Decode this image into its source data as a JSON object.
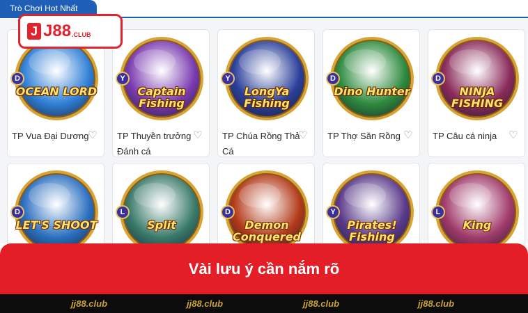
{
  "section_tab": "Trò Chơi Hot Nhất",
  "brand": {
    "mark": "J",
    "word": "J88",
    "suffix": ".CLUB"
  },
  "games": [
    {
      "name": "TP Vua Đại Dương",
      "badge": "D",
      "art": "OCEAN LORD",
      "ring": "#2f7fd6"
    },
    {
      "name": "TP Thuyền trưởng Đánh cá",
      "badge": "Y",
      "art": "Captain Fishing",
      "ring": "#7a3ab0"
    },
    {
      "name": "TP Chúa Rồng Thả Cá",
      "badge": "Y",
      "art": "LongYa Fishing",
      "ring": "#2a3f9a"
    },
    {
      "name": "TP Thợ Săn Rồng",
      "badge": "D",
      "art": "Dino Hunter",
      "ring": "#2d8a3e"
    },
    {
      "name": "TP Câu cá ninja",
      "badge": "D",
      "art": "NINJA FISHING",
      "ring": "#8a2a5a"
    },
    {
      "name": "",
      "badge": "D",
      "art": "LET'S SHOOT",
      "ring": "#2a6fc0"
    },
    {
      "name": "",
      "badge": "L",
      "art": "Split",
      "ring": "#3a7a6a"
    },
    {
      "name": "",
      "badge": "D",
      "art": "Demon Conquered",
      "ring": "#b23a1a"
    },
    {
      "name": "",
      "badge": "Y",
      "art": "Pirates! Fishing",
      "ring": "#5a3a8a"
    },
    {
      "name": "",
      "badge": "L",
      "art": "King",
      "ring": "#a03a6a"
    }
  ],
  "banner_text": "Vài lưu ý cần nắm rõ",
  "watermarks": [
    "jj88.club",
    "jj88.club",
    "jj88.club",
    "jj88.club"
  ],
  "colors": {
    "accent_blue": "#1f5fb8",
    "brand_red": "#e41e26",
    "ring_gold": "#d8a436"
  }
}
